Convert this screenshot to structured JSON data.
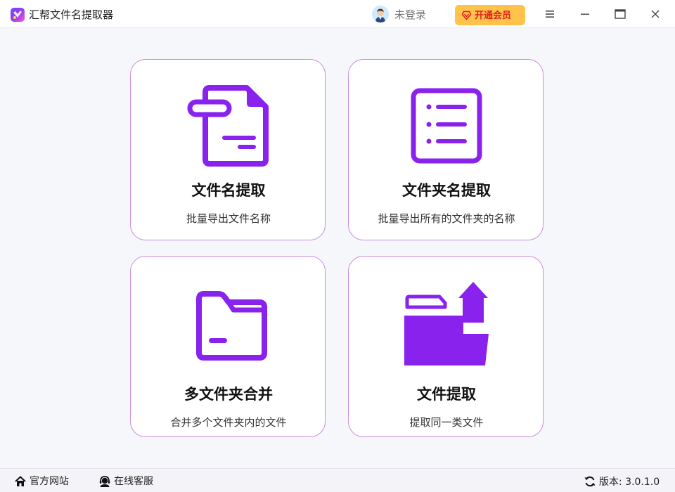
{
  "app": {
    "title": "汇帮文件名提取器",
    "login_status": "未登录",
    "vip_button": "开通会员"
  },
  "window_controls": [
    "menu-icon",
    "minimize-icon",
    "maximize-icon",
    "close-icon"
  ],
  "cards": [
    {
      "title": "文件名提取",
      "desc": "批量导出文件名称",
      "icon": "file-icon"
    },
    {
      "title": "文件夹名提取",
      "desc": "批量导出所有的文件夹的名称",
      "icon": "list-icon"
    },
    {
      "title": "多文件夹合并",
      "desc": "合并多个文件夹内的文件",
      "icon": "folder-icon"
    },
    {
      "title": "文件提取",
      "desc": "提取同一类文件",
      "icon": "folder-upload-icon"
    }
  ],
  "footer": {
    "website": "官方网站",
    "support": "在线客服",
    "version_label": "版本:",
    "version": "3.0.1.0"
  },
  "colors": {
    "accent": "#8a22ee",
    "card_border": "#c88be0",
    "vip_bg": "#ffc24a",
    "vip_text": "#e0201f"
  }
}
